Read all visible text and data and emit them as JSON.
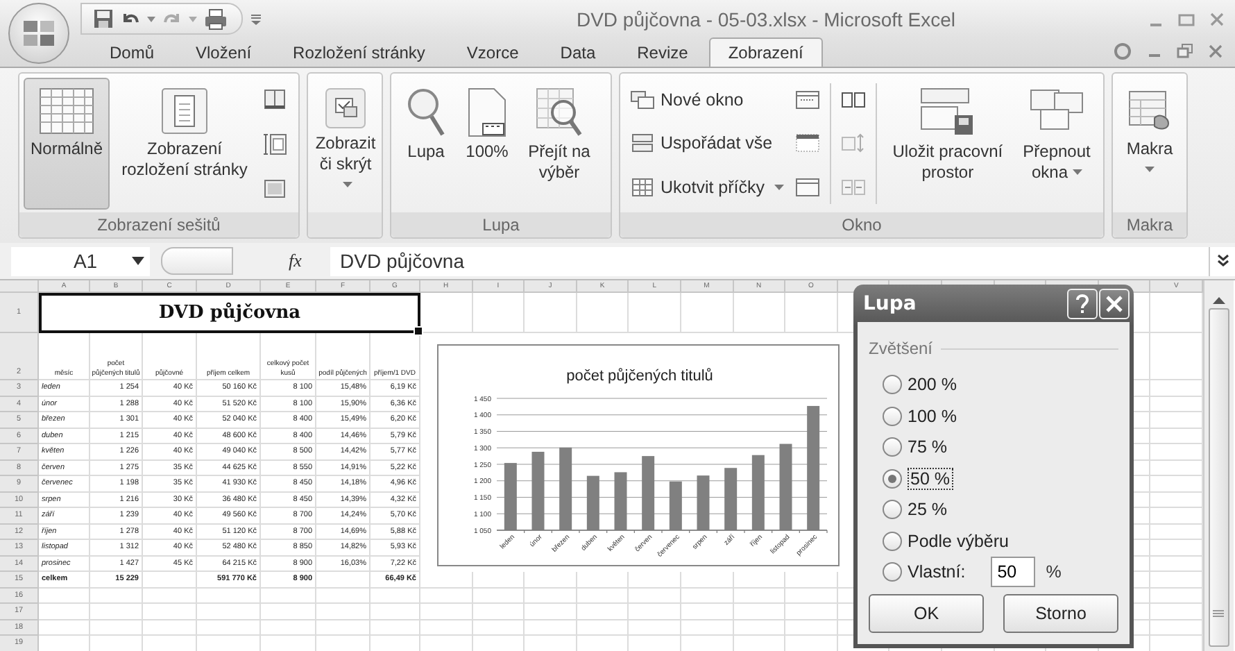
{
  "window": {
    "title": "DVD půjčovna - 05-03.xlsx - Microsoft Excel"
  },
  "tabs": [
    {
      "label": "Domů",
      "selected": false
    },
    {
      "label": "Vložení",
      "selected": false
    },
    {
      "label": "Rozložení stránky",
      "selected": false
    },
    {
      "label": "Vzorce",
      "selected": false
    },
    {
      "label": "Data",
      "selected": false
    },
    {
      "label": "Revize",
      "selected": false
    },
    {
      "label": "Zobrazení",
      "selected": true
    }
  ],
  "ribbon": {
    "groups": [
      {
        "label": "Zobrazení sešitů",
        "buttons": [
          {
            "label": "Normálně",
            "selected": true,
            "dropdown": false
          },
          {
            "label": "Zobrazení rozložení stránky",
            "selected": false,
            "dropdown": false
          }
        ]
      },
      {
        "buttons": [
          {
            "label": "Zobrazit či skrýt",
            "dropdown": true
          }
        ]
      },
      {
        "label": "Lupa",
        "buttons": [
          {
            "label": "Lupa",
            "dropdown": false
          },
          {
            "label": "100%",
            "dropdown": false
          },
          {
            "label": "Přejít na výběr",
            "dropdown": false
          }
        ]
      },
      {
        "label": "Okno",
        "small_buttons": [
          {
            "label": "Nové okno",
            "dropdown": false
          },
          {
            "label": "Uspořádat vše",
            "dropdown": false
          },
          {
            "label": "Ukotvit příčky",
            "dropdown": true
          }
        ],
        "buttons": [
          {
            "label": "Uložit pracovní prostor",
            "dropdown": false
          },
          {
            "label": "Přepnout okna",
            "dropdown": true
          }
        ]
      },
      {
        "label": "Makra",
        "buttons": [
          {
            "label": "Makra",
            "dropdown": true
          }
        ]
      }
    ]
  },
  "formula_bar": {
    "name_box": "A1",
    "function_symbol": "fx",
    "content": "DVD půjčovna"
  },
  "sheet": {
    "column_headers": [
      "A",
      "B",
      "C",
      "D",
      "E",
      "F",
      "G",
      "H",
      "I",
      "J",
      "K",
      "L",
      "M",
      "N",
      "O"
    ],
    "last_column_header": "V",
    "row_numbers": [
      "1",
      "2",
      "3",
      "4",
      "5",
      "6",
      "7",
      "8",
      "9",
      "10",
      "11",
      "12",
      "13",
      "14",
      "15",
      "16",
      "17",
      "18",
      "19"
    ],
    "title": "DVD půjčovna",
    "header_row": [
      "měsíc",
      "počet půjčených titulů",
      "půjčovné",
      "příjem celkem",
      "celkový počet kusů",
      "podíl půjčených",
      "příjem/1 DVD"
    ],
    "rows": [
      {
        "kind": "month",
        "cells": [
          "leden",
          "1 254",
          "40 Kč",
          "50 160 Kč",
          "8 100",
          "15,48%",
          "6,19 Kč"
        ]
      },
      {
        "kind": "month",
        "cells": [
          "únor",
          "1 288",
          "40 Kč",
          "51 520 Kč",
          "8 100",
          "15,90%",
          "6,36 Kč"
        ]
      },
      {
        "kind": "month",
        "cells": [
          "březen",
          "1 301",
          "40 Kč",
          "52 040 Kč",
          "8 400",
          "15,49%",
          "6,20 Kč"
        ]
      },
      {
        "kind": "month",
        "cells": [
          "duben",
          "1 215",
          "40 Kč",
          "48 600 Kč",
          "8 400",
          "14,46%",
          "5,79 Kč"
        ]
      },
      {
        "kind": "month",
        "cells": [
          "květen",
          "1 226",
          "40 Kč",
          "49 040 Kč",
          "8 500",
          "14,42%",
          "5,77 Kč"
        ]
      },
      {
        "kind": "month",
        "cells": [
          "červen",
          "1 275",
          "35 Kč",
          "44 625 Kč",
          "8 550",
          "14,91%",
          "5,22 Kč"
        ]
      },
      {
        "kind": "month",
        "cells": [
          "červenec",
          "1 198",
          "35 Kč",
          "41 930 Kč",
          "8 450",
          "14,18%",
          "4,96 Kč"
        ]
      },
      {
        "kind": "month",
        "cells": [
          "srpen",
          "1 216",
          "30 Kč",
          "36 480 Kč",
          "8 450",
          "14,39%",
          "4,32 Kč"
        ]
      },
      {
        "kind": "month",
        "cells": [
          "září",
          "1 239",
          "40 Kč",
          "49 560 Kč",
          "8 700",
          "14,24%",
          "5,70 Kč"
        ]
      },
      {
        "kind": "month",
        "cells": [
          "říjen",
          "1 278",
          "40 Kč",
          "51 120 Kč",
          "8 700",
          "14,69%",
          "5,88 Kč"
        ]
      },
      {
        "kind": "month",
        "cells": [
          "listopad",
          "1 312",
          "40 Kč",
          "52 480 Kč",
          "8 850",
          "14,82%",
          "5,93 Kč"
        ]
      },
      {
        "kind": "month",
        "cells": [
          "prosinec",
          "1 427",
          "45 Kč",
          "64 215 Kč",
          "8 900",
          "16,03%",
          "7,22 Kč"
        ]
      },
      {
        "kind": "total",
        "cells": [
          "celkem",
          "15 229",
          null,
          "591 770 Kč",
          "8 900",
          null,
          "66,49 Kč"
        ]
      }
    ],
    "chart": {
      "chart_data": {
        "type": "bar",
        "title": "počet půjčených titulů",
        "categories": [
          "leden",
          "únor",
          "březen",
          "duben",
          "květen",
          "červen",
          "červenec",
          "srpen",
          "září",
          "říjen",
          "listopad",
          "prosinec"
        ],
        "values": [
          1254,
          1288,
          1301,
          1215,
          1226,
          1275,
          1198,
          1216,
          1239,
          1278,
          1312,
          1427
        ],
        "ylim": [
          1050,
          1450
        ],
        "grid": true,
        "yticks": [
          {
            "value": 1050,
            "label": "1 050"
          },
          {
            "value": 1100,
            "label": "1 100"
          },
          {
            "value": 1150,
            "label": "1 150"
          },
          {
            "value": 1200,
            "label": "1 200"
          },
          {
            "value": 1250,
            "label": "1 250"
          },
          {
            "value": 1300,
            "label": "1 300"
          },
          {
            "value": 1350,
            "label": "1 350"
          },
          {
            "value": 1400,
            "label": "1 400"
          },
          {
            "value": 1450,
            "label": "1 450"
          }
        ]
      }
    }
  },
  "dialog": {
    "title": "Lupa",
    "group_label": "Zvětšení",
    "options": [
      {
        "label": "200 %",
        "selected": false
      },
      {
        "label": "100 %",
        "selected": false
      },
      {
        "label": "75 %",
        "selected": false
      },
      {
        "label": "50 %",
        "selected": true
      },
      {
        "label": "25 %",
        "selected": false
      },
      {
        "label": "Podle výběru",
        "selected": false
      }
    ],
    "custom": {
      "label": "Vlastní:",
      "selected": false,
      "value": "50",
      "unit": "%"
    },
    "buttons": [
      "OK",
      "Storno"
    ]
  }
}
